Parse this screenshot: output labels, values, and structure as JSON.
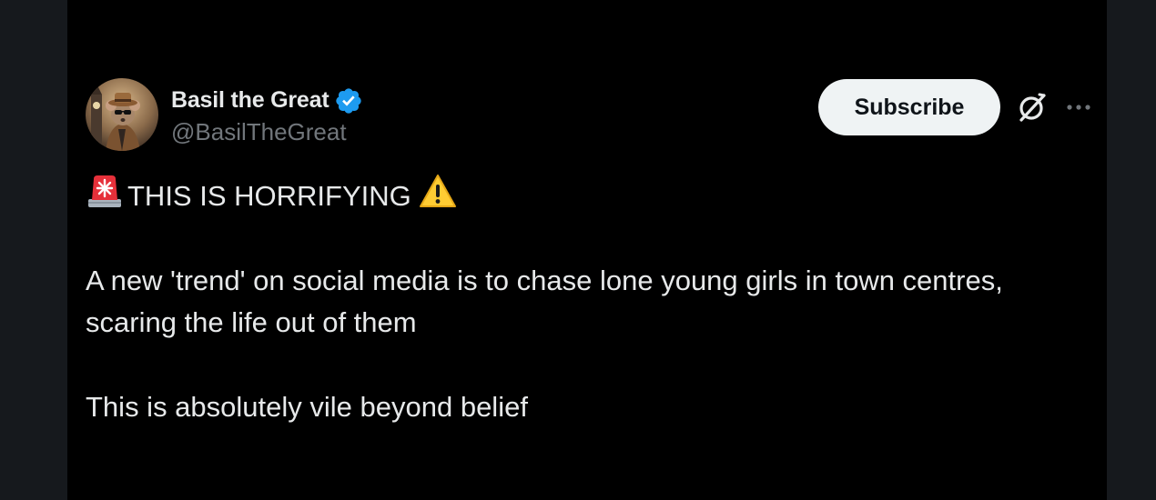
{
  "tweet": {
    "author": {
      "display_name": "Basil the Great",
      "handle": "@BasilTheGreat",
      "verified": true,
      "avatar": "avatar-mouse-detective"
    },
    "actions": {
      "subscribe_label": "Subscribe",
      "grok_icon": "grok-icon",
      "more_icon": "more-icon"
    },
    "text": {
      "headline": "THIS IS HORRIFYING",
      "headline_prefix_emoji": "police-car-light-emoji",
      "headline_suffix_emoji": "warning-emoji",
      "paragraph_1": "A new 'trend' on social media is to chase lone young girls in town centres, scaring the life out of them",
      "paragraph_2": "This is absolutely vile beyond belief"
    }
  },
  "colors": {
    "background": "#000000",
    "text_primary": "#e7e9ea",
    "text_secondary": "#71767b",
    "verified_blue": "#1d9bf0",
    "button_bg": "#eff3f4"
  }
}
